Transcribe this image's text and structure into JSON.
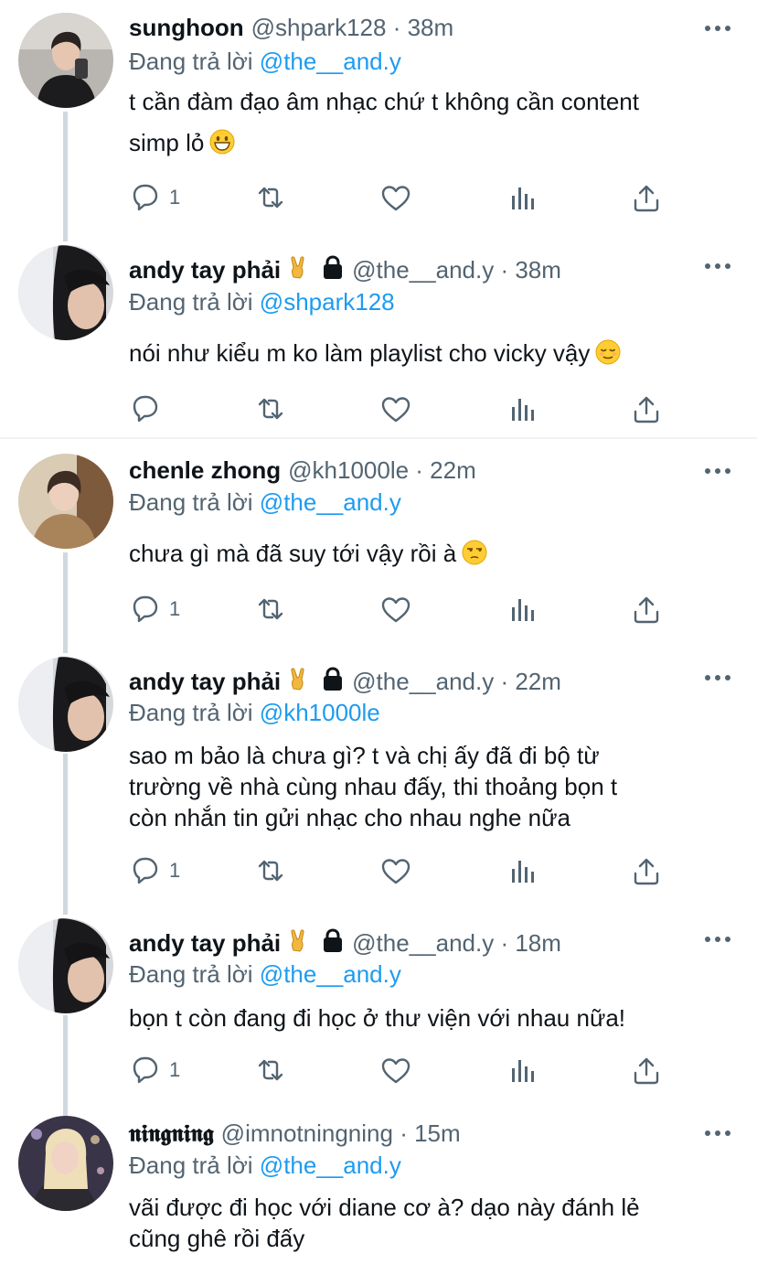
{
  "tweets": [
    {
      "name": "sunghoon",
      "handle": "@shpark128",
      "time": "· 38m",
      "replying_prefix": "Đang trả lời",
      "replying_to": "@the__and.y",
      "text_lines": [
        "t cần đàm đạo âm nhạc chứ t không cần content",
        "simp lỏ"
      ],
      "text_emoji": "grinning-face",
      "reply_count": "1"
    },
    {
      "name": "andy tay phải",
      "name_emoji": "sign-of-horns",
      "locked": true,
      "handle": "@the__and.y",
      "time": "· 38m",
      "replying_prefix": "Đang trả lời",
      "replying_to": "@shpark128",
      "text_lines": [
        "nói như kiểu m ko làm playlist cho vicky vậy"
      ],
      "text_emoji": "relieved-face",
      "reply_count": ""
    },
    {
      "name": "chenle zhong",
      "handle": "@kh1000le",
      "time": "· 22m",
      "replying_prefix": "Đang trả lời",
      "replying_to": "@the__and.y",
      "text_lines": [
        "chưa gì mà đã suy tới vậy rồi à"
      ],
      "text_emoji": "unamused-face",
      "reply_count": "1"
    },
    {
      "name": "andy tay phải",
      "name_emoji": "sign-of-horns",
      "locked": true,
      "handle": "@the__and.y",
      "time": "· 22m",
      "replying_prefix": "Đang trả lời",
      "replying_to": "@kh1000le",
      "text_lines": [
        "sao m bảo là chưa gì? t và chị ấy đã đi bộ từ",
        "trường về nhà cùng nhau đấy, thi thoảng bọn t",
        "còn nhắn tin gửi nhạc cho nhau nghe nữa"
      ],
      "reply_count": "1"
    },
    {
      "name": "andy tay phải",
      "name_emoji": "sign-of-horns",
      "locked": true,
      "handle": "@the__and.y",
      "time": "· 18m",
      "replying_prefix": "Đang trả lời",
      "replying_to": "@the__and.y",
      "text_lines": [
        "bọn t còn đang đi học ở thư viện với nhau nữa!"
      ],
      "reply_count": "1"
    },
    {
      "name": "𝖓𝖎𝖓𝖌𝖓𝖎𝖓𝖌",
      "handle": "@imnotningning",
      "time": "· 15m",
      "replying_prefix": "Đang trả lời",
      "replying_to": "@the__and.y",
      "text_lines": [
        "vãi được đi học với diane cơ à? dạo này đánh lẻ",
        "cũng ghê rồi đấy"
      ]
    }
  ],
  "icons": [
    "reply-icon",
    "retweet-icon",
    "like-icon",
    "analytics-icon",
    "share-icon",
    "more-icon",
    "lock-icon"
  ],
  "colors": {
    "link": "#1d9bf0",
    "muted": "#536471",
    "text": "#0f1419",
    "thread_line": "#cfd9de"
  }
}
